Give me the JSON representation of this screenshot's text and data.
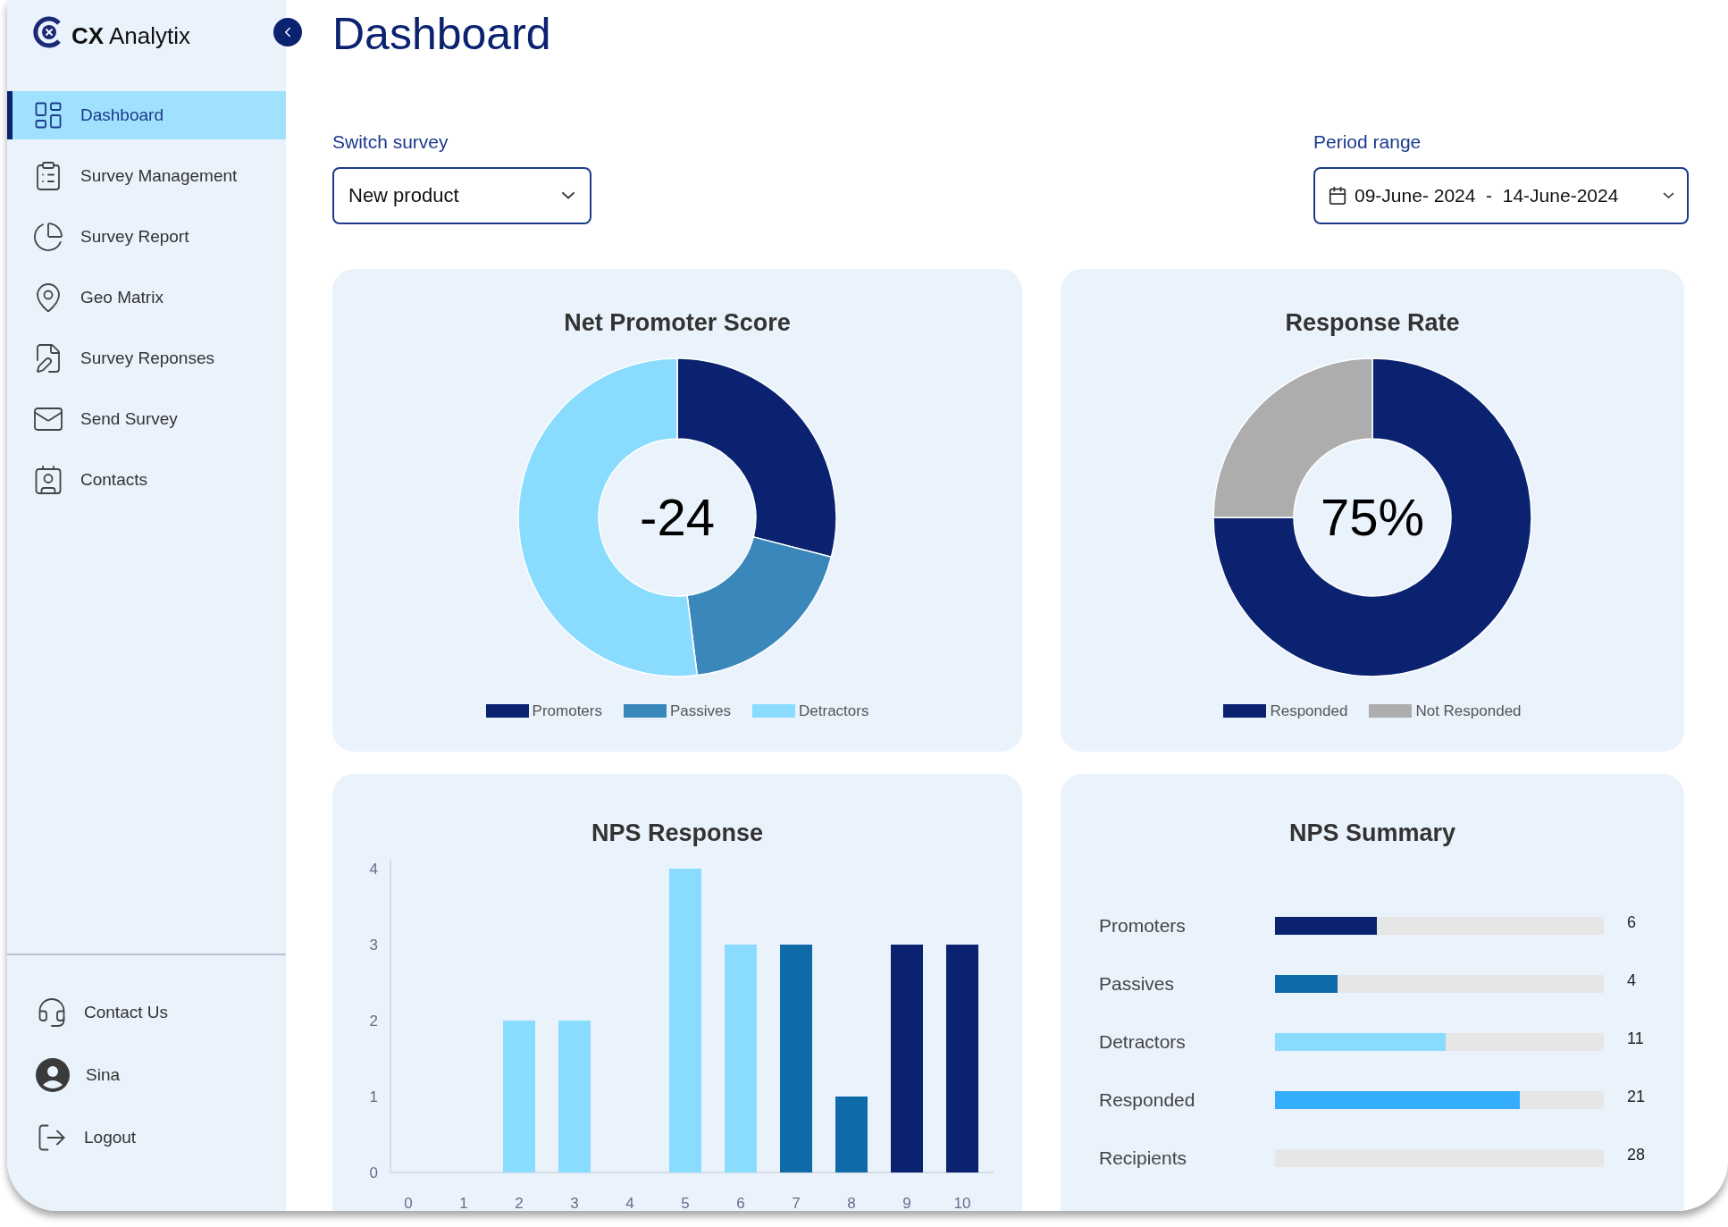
{
  "sidebar": {
    "logo": "**CX** Analytix",
    "items": [
      {
        "label": "Dashboard",
        "selected": true
      },
      {
        "label": "Survey Management",
        "selected": false
      },
      {
        "label": "Survey Report",
        "selected": false
      },
      {
        "label": "Geo Matrix",
        "selected": false
      },
      {
        "label": "Survey Reponses",
        "selected": false
      },
      {
        "label": "Send Survey",
        "selected": false
      },
      {
        "label": "Contacts",
        "selected": false
      }
    ],
    "footer_items": [
      {
        "label": "Contact Us"
      },
      {
        "label": "Sina"
      },
      {
        "label": "Logout"
      }
    ]
  },
  "page_title": "Dashboard",
  "switch_survey": {
    "label": "Switch survey",
    "value": "New product"
  },
  "period_range": {
    "label": "Period range",
    "value": "09-June- 2024  -  14-June-2024"
  },
  "nps_card": {
    "title": "Net Promoter Score",
    "center": "-24",
    "chart_data": {
      "type": "donut",
      "categories": [
        "Promoters",
        "Passives",
        "Detractors"
      ],
      "values": [
        29,
        19,
        52
      ],
      "colors": [
        "#0a2270",
        "#3a87bb",
        "#8adcfe"
      ]
    }
  },
  "response_card": {
    "title": "Response Rate",
    "center": "75%",
    "chart_data": {
      "type": "donut",
      "categories": [
        "Responded",
        "Not Responded"
      ],
      "values": [
        75,
        25
      ],
      "colors": [
        "#0a2270",
        "#adadad"
      ]
    }
  },
  "nps_response_card": {
    "title": "NPS Response",
    "chart_data": {
      "type": "bar",
      "categories": [
        "0",
        "1",
        "2",
        "3",
        "4",
        "5",
        "6",
        "7",
        "8",
        "9",
        "10"
      ],
      "ylim": [
        0,
        4
      ],
      "yticks": [
        0,
        1,
        2,
        3,
        4
      ],
      "values": [
        0,
        0,
        2,
        2,
        0,
        4,
        3,
        3,
        1,
        3,
        3
      ],
      "colors": [
        null,
        null,
        "#8adcfe",
        "#8adcfe",
        null,
        "#8adcfe",
        "#8adcfe",
        "#0f6aa8",
        "#0f6aa8",
        "#0a2270",
        "#0a2270"
      ]
    }
  },
  "summary_card": {
    "title": "NPS Summary",
    "rows": [
      {
        "label": "Promoters",
        "level": 0.31,
        "value": "6",
        "color": "#0a2270"
      },
      {
        "label": "Passives",
        "level": 0.19,
        "value": "4",
        "color": "#0f6aa8"
      },
      {
        "label": "Detractors",
        "level": 0.52,
        "value": "11",
        "color": "#8adcfe"
      },
      {
        "label": "Responded",
        "level": 0.745,
        "value": "21",
        "color": "#33adfc"
      },
      {
        "label": "Recipients",
        "value": "28"
      }
    ]
  }
}
